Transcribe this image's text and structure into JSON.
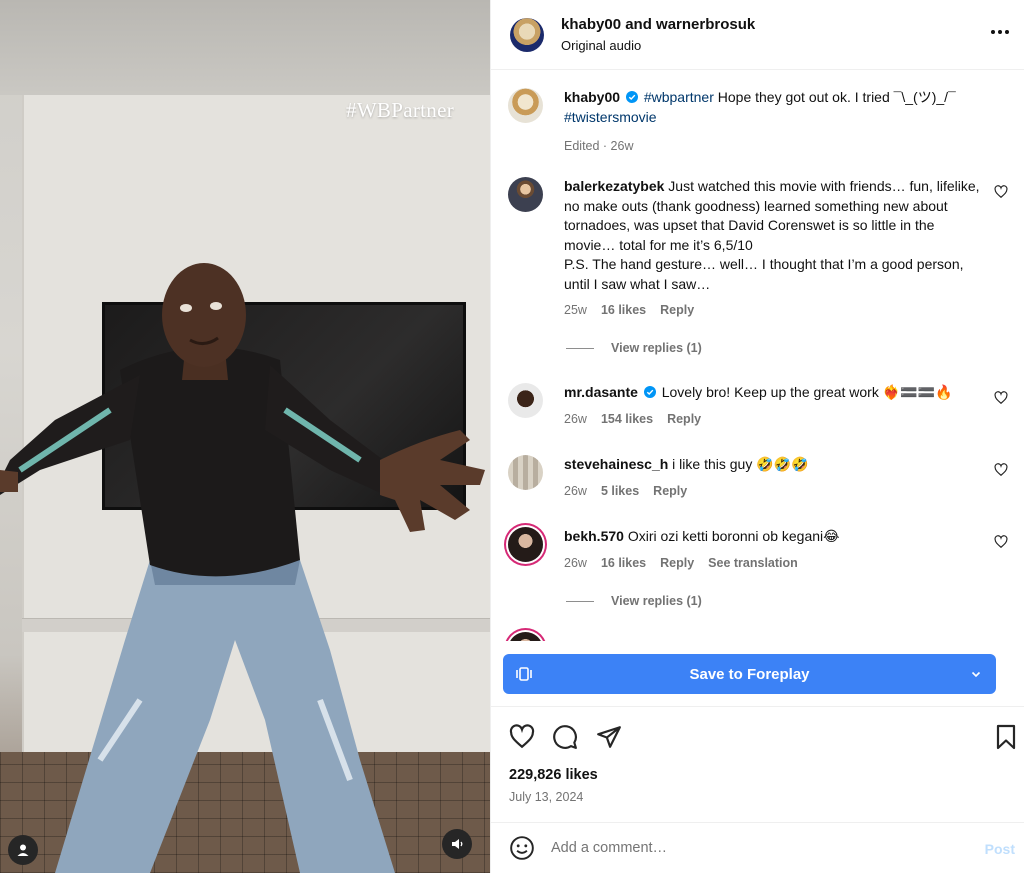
{
  "video": {
    "watermark": "#WBPartner"
  },
  "header": {
    "title": "khaby00 and warnerbrosuk",
    "subtitle": "Original audio"
  },
  "caption": {
    "username": "khaby00",
    "hashtag1": "#wbpartner",
    "text": " Hope they got out ok. I tried ¯\\_(ツ)_/¯ ",
    "hashtag2": "#twistersmovie",
    "meta": "Edited · 26w"
  },
  "comments": [
    {
      "username": "balerkezatybek",
      "text": " Just watched this movie with friends… fun, lifelike, no make outs (thank goodness) learned something new about tornadoes, was upset that David Corenswet is so little in the movie… total for me it’s 6,5/10",
      "text2": "P.S. The hand gesture… well… I thought that I’m a good person, until I saw what I saw…",
      "time": "25w",
      "likes": "16 likes",
      "reply": "Reply",
      "view_replies": "View replies (1)"
    },
    {
      "username": "mr.dasante",
      "text": " Lovely bro! Keep up the great work ❤️‍🔥🟰🟰🔥",
      "time": "26w",
      "likes": "154 likes",
      "reply": "Reply"
    },
    {
      "username": "stevehainesc_h",
      "text": " i like this guy 🤣🤣🤣",
      "time": "26w",
      "likes": "5 likes",
      "reply": "Reply"
    },
    {
      "username": "bekh.570",
      "text": " Oxiri ozi ketti boronni ob kegani😂",
      "time": "26w",
      "likes": "16 likes",
      "reply": "Reply",
      "translate": "See translation",
      "view_replies": "View replies (1)"
    }
  ],
  "save_bar": {
    "label": "Save to Foreplay"
  },
  "stats": {
    "likes": "229,826 likes",
    "date": "July 13, 2024"
  },
  "add_comment": {
    "placeholder": "Add a comment…",
    "post": "Post"
  },
  "colors": {
    "accent": "#3c82f6",
    "link": "#00376b",
    "muted": "#737373",
    "verified": "#0095f6"
  }
}
